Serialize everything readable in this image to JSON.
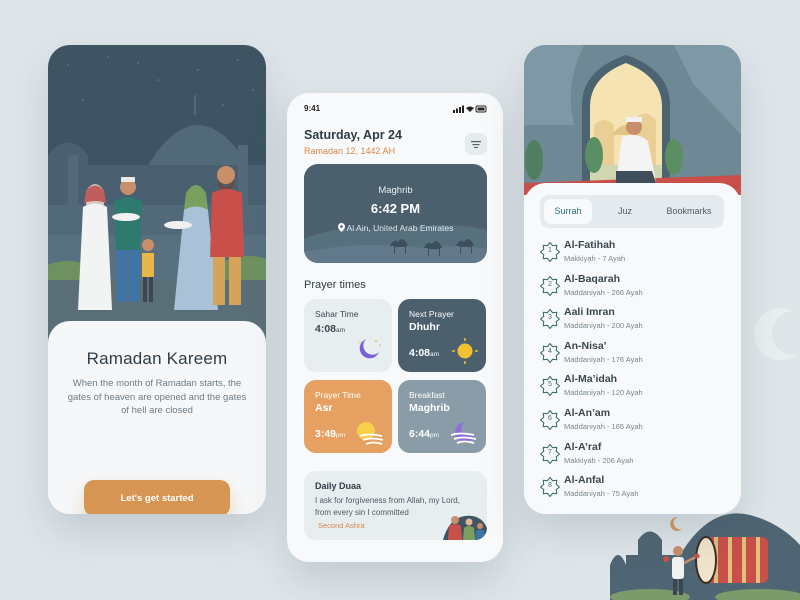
{
  "colors": {
    "background": "#dfe6ea",
    "accent_orange": "#d69552",
    "dark_slate": "#4b5f6d",
    "teal": "#2f6f73"
  },
  "welcome": {
    "title": "Ramadan Kareem",
    "description": "When the month of Ramadan starts, the gates of heaven are opened and the gates of hell are closed",
    "cta_label": "Let's get started"
  },
  "home": {
    "status_time": "9:41",
    "date": "Saturday, Apr 24",
    "hijri_date": "Ramadan 12, 1442 AH",
    "current_prayer": {
      "name": "Maghrib",
      "time": "6:42 PM",
      "location": "Al Ain, United Arab Emirates"
    },
    "section_title": "Prayer times",
    "tiles": [
      {
        "label": "Sahar Time",
        "name": "",
        "time": "4:08",
        "suffix": "am",
        "icon": "moon-icon"
      },
      {
        "label": "Next Prayer",
        "name": "Dhuhr",
        "time": "4:08",
        "suffix": "am",
        "icon": "sun-icon"
      },
      {
        "label": "Prayer Time",
        "name": "Asr",
        "time": "3:49",
        "suffix": "pm",
        "icon": "sun-cloud-icon"
      },
      {
        "label": "Breakfast",
        "name": "Maghrib",
        "time": "6:44",
        "suffix": "pm",
        "icon": "moon-cloud-icon"
      }
    ],
    "duaa": {
      "title": "Daily Duaa",
      "text": "I ask for forgiveness from Allah, my Lord, from every sin I committed",
      "source": "Second Ashra"
    }
  },
  "quran": {
    "tabs": [
      "Surrah",
      "Juz",
      "Bookmarks"
    ],
    "active_tab": "Surrah",
    "surahs": [
      {
        "number": "1",
        "name": "Al-Fatihah",
        "meta": "Makkiyah - 7 Ayah"
      },
      {
        "number": "2",
        "name": "Al-Baqarah",
        "meta": "Maddaniyah - 266 Ayah"
      },
      {
        "number": "3",
        "name": "Aali Imran",
        "meta": "Maddaniyah - 200 Ayah"
      },
      {
        "number": "4",
        "name": "An-Nisa’",
        "meta": "Maddaniyah - 176 Ayah"
      },
      {
        "number": "5",
        "name": "Al-Ma’idah",
        "meta": "Maddaniyah - 120 Ayah"
      },
      {
        "number": "6",
        "name": "Al-An’am",
        "meta": "Maddaniyah - 165 Ayah"
      },
      {
        "number": "7",
        "name": "Al-A’raf",
        "meta": "Makkiyah - 206 Ayah"
      },
      {
        "number": "8",
        "name": "Al-Anfal",
        "meta": "Maddaniyah - 75 Ayah"
      }
    ]
  }
}
